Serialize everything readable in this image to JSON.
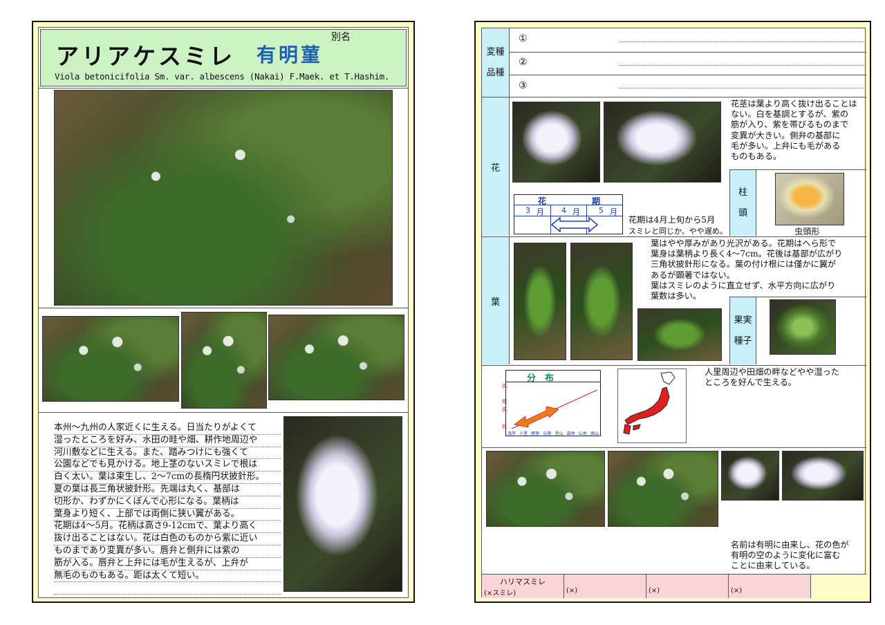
{
  "left": {
    "title_jp": "アリアケスミレ",
    "title_alt": "有明菫",
    "alias_label": "別名",
    "scientific_name": "Viola betonicifolia Sm. var. albescens (Nakai) F.Maek. et T.Hashim.",
    "description_lines": [
      "本州～九州の人家近くに生える。日当たりがよくて",
      "湿ったところを好み、水田の畦や畑、耕作地周辺や",
      "河川敷などに生える。また、踏みつけにも強くて",
      "公園などでも見かける。地上茎のないスミレで根は",
      "白く太い。葉は束生し、2～7cmの長楕円状披針形。",
      "夏の葉は長三角状披針形。先端は丸く、基部は",
      "切形か、わずかにくぼんで心形になる。葉柄は",
      "葉身より短く、上部では両側に狭い翼がある。",
      "花期は4～5月。花柄は高さ9-12cmで、葉より高く",
      "抜け出ることはない。花は白色のものから紫に近い",
      "ものまであり変異が多い。唇弁と側弁には紫の",
      "筋が入る。唇弁と上弁には毛が生えるが、上弁が",
      "無毛のものもある。距は太くて短い。"
    ]
  },
  "right": {
    "labels": {
      "variety_1": "変種",
      "variety_2": "品種",
      "flower": "花",
      "leaf": "葉",
      "stigma_1": "柱",
      "stigma_2": "頭",
      "fruit_1": "果実",
      "fruit_2": "種子"
    },
    "variety_items": [
      "①",
      "②",
      "③"
    ],
    "flower_text": [
      "花茎は葉より高く抜け出ることは",
      "ない。白を基調とするが、紫の",
      "筋が入り、紫を帯びるものまで",
      "変異が大きい。側弁の基部に",
      "毛が多い。上弁にも毛がある",
      "ものもある。"
    ],
    "stigma_caption": "虫頭形",
    "flower_period": {
      "title_left": "花",
      "title_right": "期",
      "months": [
        "3",
        "4",
        "5"
      ],
      "month_unit": "月"
    },
    "period_text_1": "花期は4月上旬から5月",
    "period_text_2": "スミレと同じか、やや遅め。",
    "leaf_text": [
      "葉はやや厚みがあり光沢がある。花期はへら形で",
      "葉身は葉柄より長く4～7cm。花後は基部が広がり",
      "三角状披針形になる。葉の付け根には僅かに翼が",
      "あるが顕著ではない。",
      "葉はスミレのように直立せず、水平方向に広がり",
      "葉数は多い。"
    ],
    "distribution": {
      "title": "分　布",
      "y_top": "高",
      "y_mid_1": "標",
      "y_mid_2": "高",
      "y_bottom": "低",
      "x_labels": [
        "海岸",
        "人里",
        "野原",
        "丘陵",
        "里山",
        "森林",
        "山地",
        "高山"
      ]
    },
    "habitat_text": [
      "人里周辺や田畑の畔などやや湿った",
      "ところを好んで生える。"
    ],
    "name_origin": [
      "名前は有明に由来し、花の色が",
      "有明の空のように変化に富む",
      "ことに由来している。"
    ],
    "related": [
      {
        "name": "ハリマスミレ",
        "note": "(×スミレ)"
      },
      {
        "name": "",
        "note": "(×)"
      },
      {
        "name": "",
        "note": "(×)"
      },
      {
        "name": "",
        "note": "(×)"
      }
    ]
  }
}
